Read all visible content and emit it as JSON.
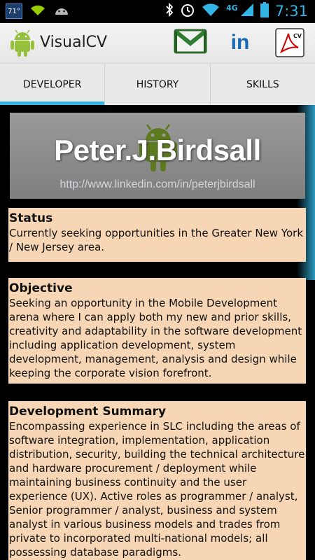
{
  "status_bar": {
    "weather_temp": "71°",
    "network_label": "4G",
    "time": "7:31"
  },
  "action_bar": {
    "title": "VisualCV",
    "pdf_label": "CV",
    "linkedin_label": "in"
  },
  "tabs": [
    {
      "label": "DEVELOPER",
      "active": true
    },
    {
      "label": "HISTORY",
      "active": false
    },
    {
      "label": "SKILLS",
      "active": false
    }
  ],
  "banner": {
    "name": "Peter.J.Birdsall",
    "url": "http://www.linkedin.com/in/peterjbirdsall"
  },
  "sections": [
    {
      "title": "Status",
      "body": "Currently seeking opportunities in the Greater New York / New Jersey area."
    },
    {
      "title": "Objective",
      "body": "Seeking an opportunity in the Mobile Development arena where I can apply both my new and prior skills, creativity and adaptability in the software development including application development, system development, management, analysis and design while keeping the corporate vision forefront."
    },
    {
      "title": "Development Summary",
      "body": "Encompassing experience in SLC including the areas of software integration, implementation, application distribution, security, building the technical architecture and hardware procurement / deployment while maintaining business continuity and the user experience (UX). Active roles as programmer / analyst, Senior programmer / analyst, business and system analyst in various business models and trades from private to incorporated multi-national models; all possessing database paradigms."
    }
  ],
  "colors": {
    "accent": "#33b5e5",
    "card_background": "#f7d6b5",
    "android_green": "#97c03d"
  }
}
